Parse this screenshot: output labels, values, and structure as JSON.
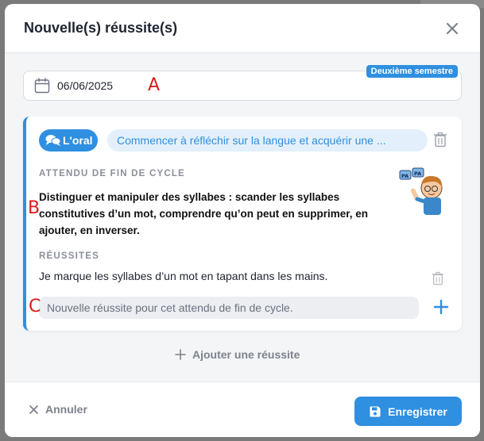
{
  "modal": {
    "title": "Nouvelle(s) réussite(s)"
  },
  "date_field": {
    "value": "06/06/2025",
    "marker": "A",
    "semester_badge": "Deuxième semestre"
  },
  "card": {
    "domain_label": "L'oral",
    "competence_label": "Commencer à réfléchir sur la langue et acquérir une ...",
    "attendu_heading": "ATTENDU DE FIN DE CYCLE",
    "attendu_text": "Distinguer et manipuler des syllabes : scander les syllabes constitutives d’un mot, comprendre qu’on peut en supprimer, en ajouter, en inverser.",
    "marker_b": "B",
    "reussites_heading": "RÉUSSITES",
    "reussites": [
      "Je marque les syllabes d’un mot en tapant dans les mains."
    ],
    "marker_c": "C",
    "new_reussite_placeholder": "Nouvelle réussite pour cet attendu de fin de cycle.",
    "illustration_text": "PA PA"
  },
  "add_reussite_label": "Ajouter une réussite",
  "footer": {
    "cancel_label": "Annuler",
    "save_label": "Enregistrer"
  },
  "colors": {
    "accent": "#2f8fe0",
    "marker_red": "#d81e1e"
  }
}
